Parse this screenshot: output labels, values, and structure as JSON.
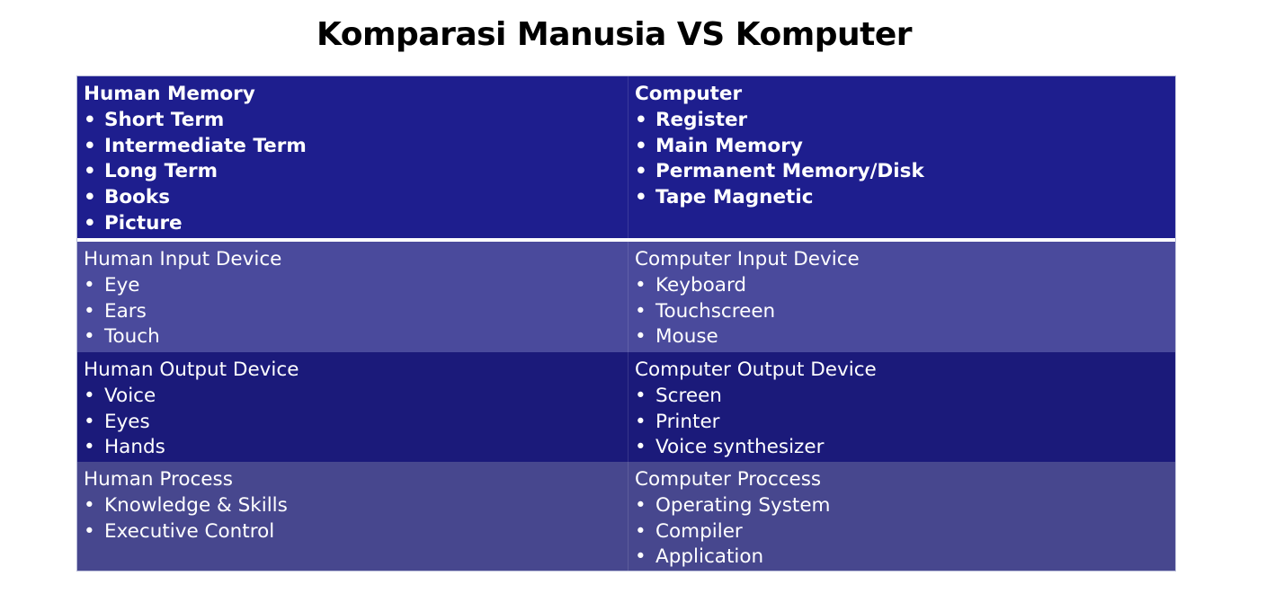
{
  "title": "Komparasi Manusia VS Komputer",
  "rows": [
    {
      "left": {
        "heading": "Human Memory",
        "items": [
          "Short Term",
          "Intermediate Term",
          "Long Term",
          "Books",
          "Picture"
        ]
      },
      "right": {
        "heading": "Computer",
        "items": [
          "Register",
          "Main Memory",
          "Permanent Memory/Disk",
          "Tape Magnetic"
        ]
      }
    },
    {
      "left": {
        "heading": "Human Input Device",
        "items": [
          "Eye",
          "Ears",
          "Touch"
        ]
      },
      "right": {
        "heading": "Computer Input Device",
        "items": [
          "Keyboard",
          "Touchscreen",
          "Mouse"
        ]
      }
    },
    {
      "left": {
        "heading": "Human Output Device",
        "items": [
          "Voice",
          "Eyes",
          "Hands"
        ]
      },
      "right": {
        "heading": "Computer Output Device",
        "items": [
          "Screen",
          "Printer",
          "Voice synthesizer"
        ]
      }
    },
    {
      "left": {
        "heading": "Human Process",
        "items": [
          "Knowledge & Skills",
          "Executive Control"
        ]
      },
      "right": {
        "heading": "Computer Proccess",
        "items": [
          "Operating System",
          "Compiler",
          "Application"
        ]
      }
    }
  ],
  "bullet_glyph": "•",
  "colors": {
    "row_memory": "#1e1e8e",
    "row_input": "#4a4a9c",
    "row_output": "#1b1a7a",
    "row_process": "#47478e",
    "text": "#ffffff"
  }
}
